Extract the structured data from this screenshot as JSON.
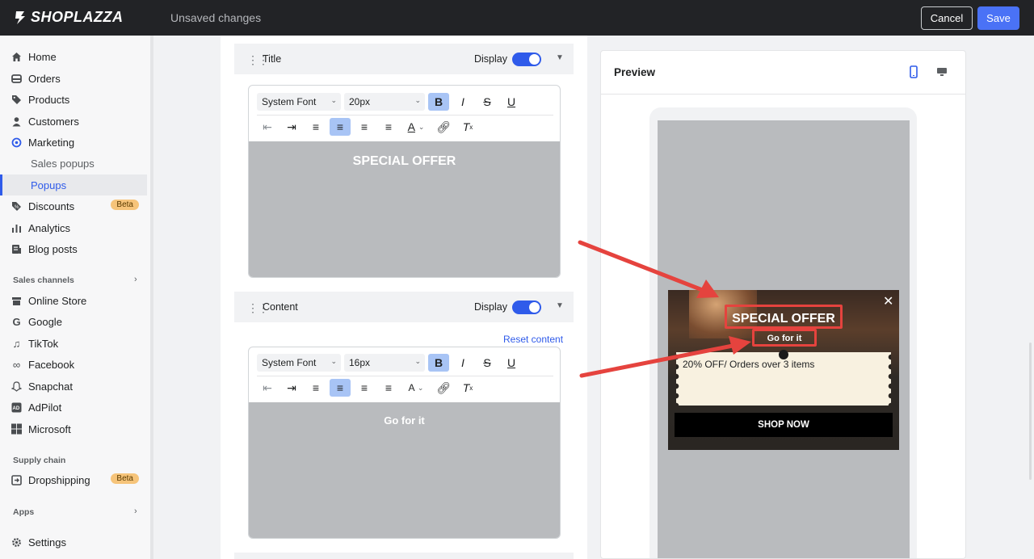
{
  "topbar": {
    "brand": "SHOPLAZZA",
    "status": "Unsaved changes",
    "cancel_label": "Cancel",
    "save_label": "Save"
  },
  "sidebar": {
    "items": [
      {
        "label": "Home",
        "icon": "home-icon"
      },
      {
        "label": "Orders",
        "icon": "orders-icon"
      },
      {
        "label": "Products",
        "icon": "tag-icon"
      },
      {
        "label": "Customers",
        "icon": "person-icon"
      },
      {
        "label": "Marketing",
        "icon": "target-icon"
      },
      {
        "label": "Sales popups"
      },
      {
        "label": "Popups"
      },
      {
        "label": "Discounts",
        "icon": "discount-icon",
        "badge": "Beta"
      },
      {
        "label": "Analytics",
        "icon": "bar-chart-icon"
      },
      {
        "label": "Blog posts",
        "icon": "blog-icon"
      }
    ],
    "sales_channels_label": "Sales channels",
    "channels": [
      {
        "label": "Online Store",
        "icon": "store-icon"
      },
      {
        "label": "Google",
        "icon": "google-icon"
      },
      {
        "label": "TikTok",
        "icon": "tiktok-icon"
      },
      {
        "label": "Facebook",
        "icon": "meta-icon"
      },
      {
        "label": "Snapchat",
        "icon": "snapchat-icon"
      },
      {
        "label": "AdPilot",
        "icon": "adpilot-icon"
      },
      {
        "label": "Microsoft",
        "icon": "microsoft-icon"
      }
    ],
    "supply_chain_label": "Supply chain",
    "dropshipping": {
      "label": "Dropshipping",
      "badge": "Beta"
    },
    "apps_label": "Apps",
    "settings_label": "Settings"
  },
  "editor": {
    "title_section": {
      "label": "Title",
      "display_label": "Display",
      "font": "System Font",
      "size": "20px",
      "text": "SPECIAL OFFER"
    },
    "content_section": {
      "label": "Content",
      "display_label": "Display",
      "reset_label": "Reset content",
      "font": "System Font",
      "size": "16px",
      "text": "Go for it"
    }
  },
  "preview": {
    "title": "Preview",
    "popup": {
      "title": "SPECIAL OFFER",
      "subtitle": "Go for it",
      "coupon_text": "20% OFF/ Orders over 3 items",
      "button_label": "SHOP NOW"
    }
  },
  "colors": {
    "accent": "#2f5bea",
    "save": "#4a72f6",
    "topbar": "#222326",
    "annotation_red": "#e5433e",
    "badge": "#f6c47a"
  }
}
